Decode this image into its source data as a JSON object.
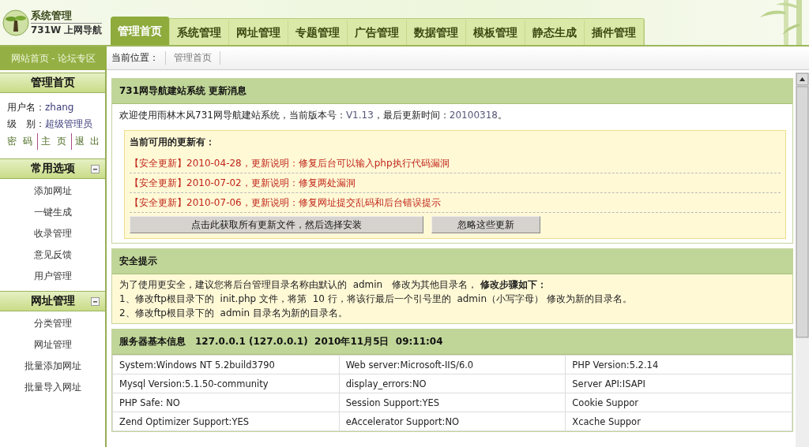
{
  "logo": {
    "title": "系统管理",
    "subtitle": "731W 上网导航"
  },
  "tabs": [
    {
      "label": "管理首页",
      "selected": true
    },
    {
      "label": "系统管理",
      "selected": false
    },
    {
      "label": "网址管理",
      "selected": false
    },
    {
      "label": "专题管理",
      "selected": false
    },
    {
      "label": "广告管理",
      "selected": false
    },
    {
      "label": "数据管理",
      "selected": false
    },
    {
      "label": "模板管理",
      "selected": false
    },
    {
      "label": "静态生成",
      "selected": false
    },
    {
      "label": "插件管理",
      "selected": false
    }
  ],
  "site_links": "网站首页 - 论坛专区",
  "breadcrumb": {
    "label": "当前位置：",
    "items": [
      "管理首页"
    ]
  },
  "sidebar": {
    "home": {
      "title": "管理首页",
      "user": [
        {
          "label": "用户名：",
          "value": "zhang"
        },
        {
          "label": "级　别：",
          "value": "超级管理员"
        }
      ],
      "links": [
        "密 码",
        "主 页",
        "退 出"
      ]
    },
    "sections": [
      {
        "title": "常用选项",
        "expanded": true,
        "items": [
          "添加网址",
          "一键生成",
          "收录管理",
          "意见反馈",
          "用户管理"
        ]
      },
      {
        "title": "网址管理",
        "expanded": true,
        "items": [
          "分类管理",
          "网址管理",
          "批量添加网址",
          "批量导入网址"
        ]
      }
    ]
  },
  "update_panel": {
    "title": "731网导航建站系统  更新消息",
    "welcome": [
      {
        "kind": "text",
        "text": "欢迎使用雨林木风731网导航建站系统，当前版本号："
      },
      {
        "kind": "value",
        "text": "V1.13"
      },
      {
        "kind": "text",
        "text": "，最后更新时间："
      },
      {
        "kind": "value",
        "text": "20100318"
      },
      {
        "kind": "text",
        "text": "。"
      }
    ],
    "updates_heading": "当前可用的更新有：",
    "updates": [
      "【安全更新】2010-04-28，更新说明：修复后台可以输入php执行代码漏洞",
      "【安全更新】2010-07-02，更新说明：修复两处漏洞",
      "【安全更新】2010-07-06，更新说明：修复网址提交乱码和后台错误提示"
    ],
    "buttons": [
      "点击此获取所有更新文件，然后选择安装",
      "忽略这些更新"
    ]
  },
  "security_panel": {
    "title": "安全提示",
    "lines": [
      "为了使用更安全，建议您将后台管理目录名称由默认的  admin   修改为其他目录名， **修改步骤如下：**",
      "1、修改ftp根目录下的  init.php 文件，将第  10 行，将该行最后一个引号里的  admin（小写字母） 修改为新的目录名。",
      "2、修改ftp根目录下的  admin 目录名为新的目录名。"
    ]
  },
  "server_panel": {
    "title": "服务器基本信息",
    "details": "127.0.0.1 (127.0.0.1)  2010年11月5日  09:11:04",
    "rows": [
      [
        "System:Windows NT 5.2build3790",
        "Web server:Microsoft-IIS/6.0",
        "PHP Version:5.2.14"
      ],
      [
        "Mysql Version:5.1.50-community",
        "display_errors:NO",
        "Server API:ISAPI"
      ],
      [
        "PHP Safe: NO",
        "Session Support:YES",
        "Cookie Suppor"
      ],
      [
        "Zend Optimizer Support:YES",
        "eAccelerator Support:NO",
        "Xcache Suppor"
      ]
    ]
  }
}
